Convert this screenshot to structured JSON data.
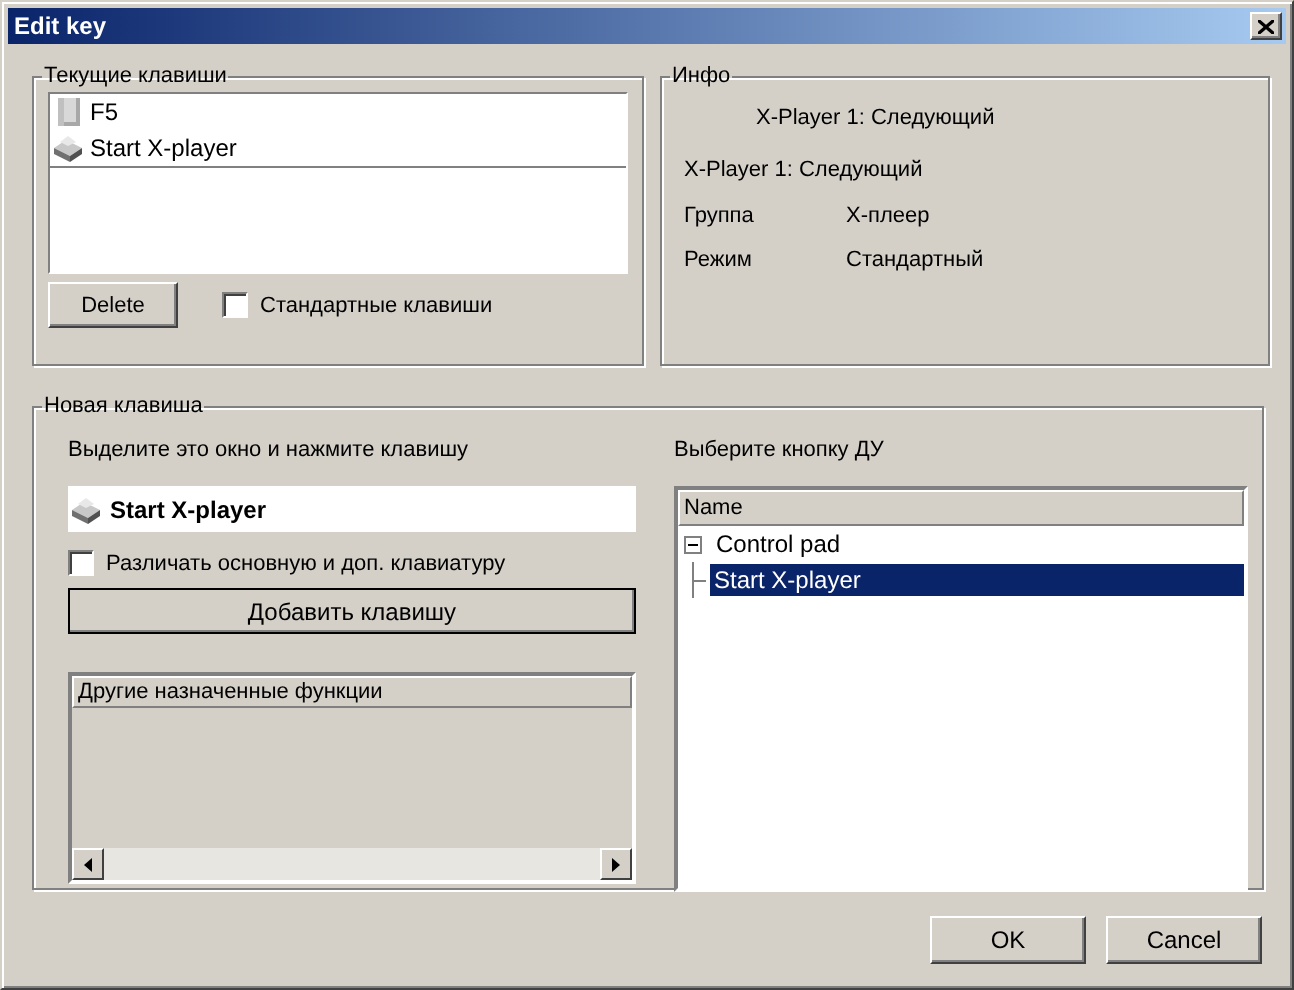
{
  "window": {
    "title": "Edit key"
  },
  "current_keys": {
    "title": "Текущие клавиши",
    "items": [
      {
        "label": "F5",
        "kind": "key"
      },
      {
        "label": "Start X-player",
        "kind": "remote"
      }
    ],
    "delete_button": "Delete",
    "standard_keys": {
      "label": "Стандартные клавиши",
      "checked": false
    }
  },
  "info": {
    "title": "Инфо",
    "line_1": "X-Player 1: Следующий",
    "line_2": "X-Player 1: Следующий",
    "rows": [
      {
        "label": "Группа",
        "value": "X-плеер"
      },
      {
        "label": "Режим",
        "value": "Стандартный"
      }
    ]
  },
  "new_key": {
    "title": "Новая клавиша",
    "instruction": "Выделите это окно и нажмите клавишу",
    "captured_key": {
      "label": "Start X-player",
      "kind": "remote"
    },
    "distinguish": {
      "label": "Различать основную и доп. клавиатуру",
      "checked": false
    },
    "add_button": "Добавить клавишу",
    "other_functions": {
      "columns": [
        "Другие назначенные функции"
      ]
    },
    "remote_prompt": "Выберите кнопку ДУ",
    "remote_tree": {
      "columns": [
        "Name"
      ],
      "items": [
        {
          "label": "Control pad",
          "expanded": true,
          "selected": false,
          "children": [
            {
              "label": "Start X-player",
              "selected": true
            }
          ]
        }
      ]
    }
  },
  "buttons": [
    "OK",
    "Cancel"
  ]
}
